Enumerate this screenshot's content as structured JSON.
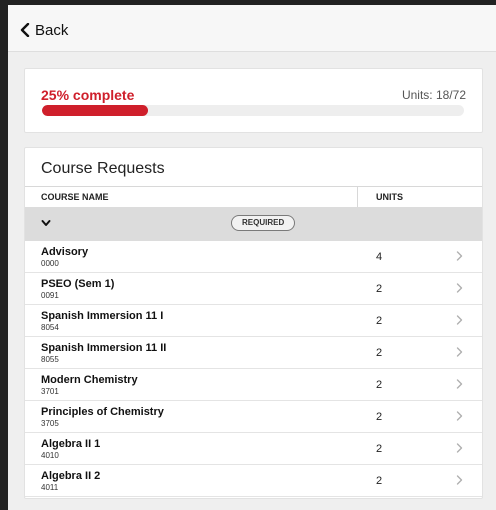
{
  "header": {
    "back_label": "Back"
  },
  "progress": {
    "percent_label": "25% complete",
    "units_label": "Units: 18/72",
    "fraction": 0.25
  },
  "course_requests": {
    "title": "Course Requests",
    "columns": {
      "course_name": "COURSE NAME",
      "units": "UNITS"
    },
    "group": {
      "badge": "REQUIRED"
    },
    "rows": [
      {
        "name": "Advisory",
        "code": "0000",
        "units": "4"
      },
      {
        "name": "PSEO (Sem 1)",
        "code": "0091",
        "units": "2"
      },
      {
        "name": "Spanish Immersion 11 I",
        "code": "8054",
        "units": "2"
      },
      {
        "name": "Spanish Immersion 11 II",
        "code": "8055",
        "units": "2"
      },
      {
        "name": "Modern Chemistry",
        "code": "3701",
        "units": "2"
      },
      {
        "name": "Principles of Chemistry",
        "code": "3705",
        "units": "2"
      },
      {
        "name": "Algebra II 1",
        "code": "4010",
        "units": "2"
      },
      {
        "name": "Algebra II 2",
        "code": "4011",
        "units": "2"
      }
    ]
  },
  "colors": {
    "accent": "#cf1f2b"
  }
}
